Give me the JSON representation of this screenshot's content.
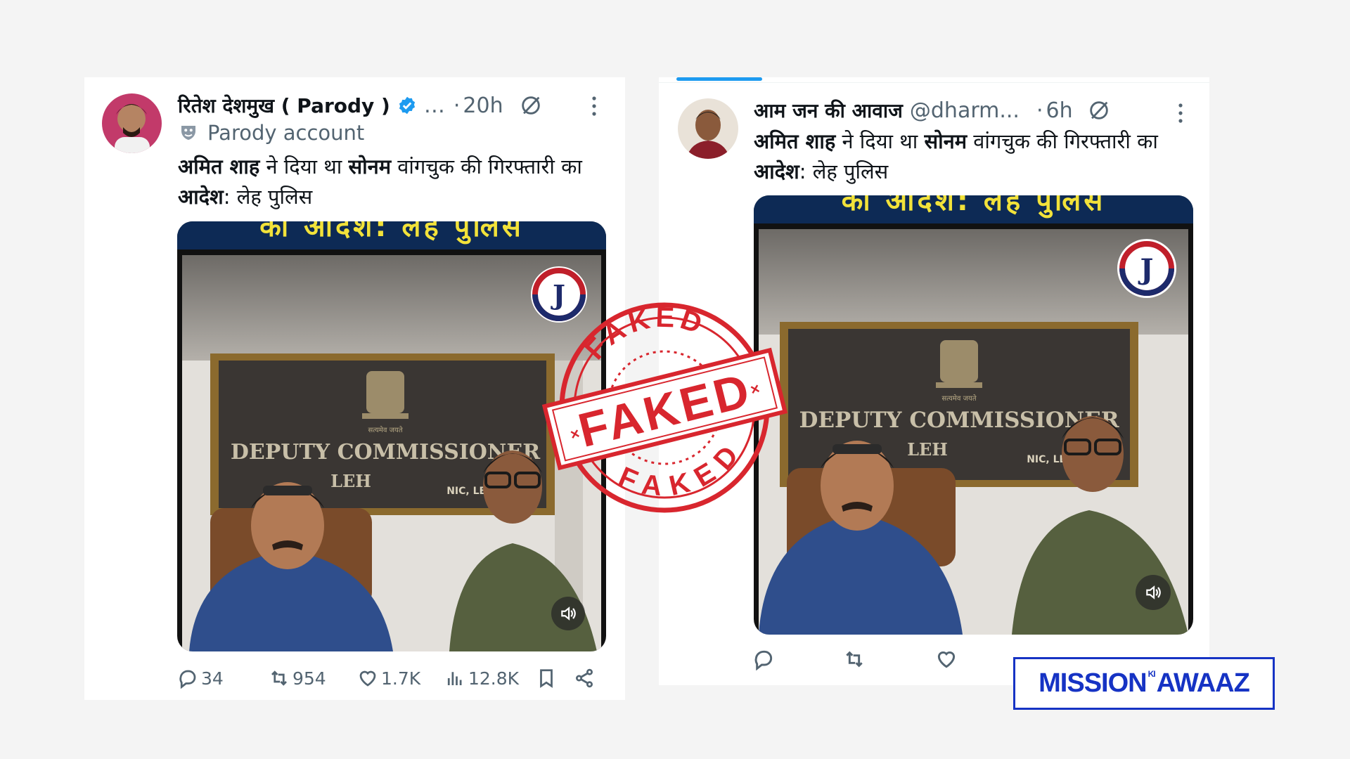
{
  "tweets": [
    {
      "name": "रितेश देशमुख ( Parody )",
      "ellipsis": "…",
      "separator": "·",
      "time": "20h",
      "label": "Parody account",
      "text_bold_1": "अमित शाह",
      "text_1": " ने दिया था ",
      "text_bold_2": "सोनम",
      "text_2": " वांगचुक की गिरफ्तारी का ",
      "text_bold_3": "आदेश",
      "text_3": ": लेह पुलिस",
      "stats": {
        "replies": "34",
        "reposts": "954",
        "likes": "1.7K",
        "views": "12.8K"
      }
    },
    {
      "name": "आम जन की आवाज",
      "handle": "@dharm...",
      "separator": "·",
      "time": "6h",
      "text_bold_1": "अमित शाह",
      "text_1": " ने दिया था ",
      "text_bold_2": "सोनम",
      "text_2": " वांगचुक की गिरफ्तारी का ",
      "text_bold_3": "आदेश",
      "text_3": ": लेह पुलिस"
    }
  ],
  "video": {
    "banner_text": "का आदेश: लेह पुलिस",
    "board_title": "DEPUTY COMMISSIONER",
    "board_subtitle": "LEH",
    "board_note": "NIC, LEH",
    "emblem_caption": "सत्यमेव जयते",
    "logo_letter": "J"
  },
  "stamp": {
    "main": "FAKED",
    "ring_top": "FAKED",
    "ring_bottom": "FAKED"
  },
  "brand": {
    "part1": "MISSION",
    "ki": "KI",
    "part2": "AWAAZ"
  },
  "colors": {
    "stamp_red": "#d8262e",
    "brand_blue": "#1633c4",
    "verified": "#1d9bf0",
    "banner": "#0d2a55"
  }
}
